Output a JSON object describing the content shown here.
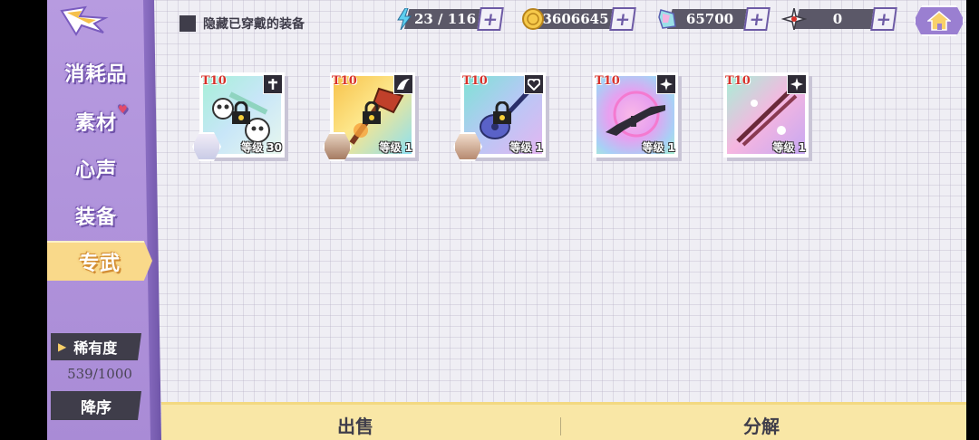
{
  "header": {
    "hide_worn_label": "隐藏已穿戴的装备",
    "resources": [
      {
        "name": "stamina",
        "icon": "lightning-icon",
        "value": "23 / 116"
      },
      {
        "name": "gold",
        "icon": "coin-icon",
        "value": "3606645"
      },
      {
        "name": "gems",
        "icon": "crystal-icon",
        "value": "65700"
      },
      {
        "name": "tokens",
        "icon": "shuriken-icon",
        "value": "0"
      }
    ]
  },
  "sidebar": {
    "items": [
      {
        "label": "消耗品"
      },
      {
        "label": "素材"
      },
      {
        "label": "心声"
      },
      {
        "label": "装备"
      },
      {
        "label": "专武"
      }
    ],
    "active_index": 4,
    "rarity_label": "稀有度",
    "capacity": "539/1000",
    "sort_label": "降序"
  },
  "items": [
    {
      "tier": "T10",
      "level": "等级 30",
      "locked": true,
      "type_icon": "cross-icon",
      "owner": true
    },
    {
      "tier": "T10",
      "level": "等级 1",
      "locked": true,
      "type_icon": "wing-icon",
      "owner": true
    },
    {
      "tier": "T10",
      "level": "等级 1",
      "locked": true,
      "type_icon": "heart-icon",
      "owner": true
    },
    {
      "tier": "T10",
      "level": "等级 1",
      "locked": false,
      "type_icon": "star-burst-icon",
      "owner": false
    },
    {
      "tier": "T10",
      "level": "等级 1",
      "locked": false,
      "type_icon": "star-burst-icon",
      "owner": false
    }
  ],
  "footer": {
    "sell_label": "出售",
    "dismantle_label": "分解"
  },
  "colors": {
    "sidebar": "#a98bd6",
    "active_tab": "#f9d98a",
    "footer": "#f9e7a6",
    "tier_text": "#d8312a"
  }
}
